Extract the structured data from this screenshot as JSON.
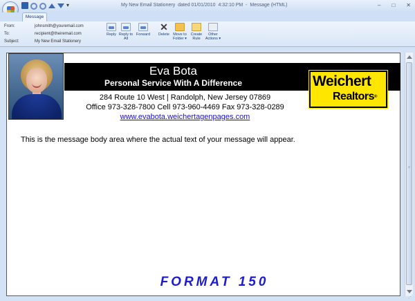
{
  "window": {
    "title": "My New Email Stationery  dated 01/01/2010  4:32:10 PM  -  Message (HTML)",
    "controls": [
      "–",
      "□",
      "✕"
    ]
  },
  "quick_access_icons": [
    "save-icon",
    "undo-icon",
    "redo-icon",
    "previous-item-icon",
    "next-item-icon",
    "customize-icon"
  ],
  "tabs": [
    {
      "label": "Message"
    }
  ],
  "header_fields": [
    {
      "label": "From:",
      "value": "johnsmith@youremail.com"
    },
    {
      "label": "To:",
      "value": "recipient@theiremail.com"
    },
    {
      "label": "Subject:",
      "value": "My New Email Stationery"
    }
  ],
  "ribbon": {
    "reply": "Reply",
    "reply_all": "Reply to All",
    "forward": "Forward",
    "delete": "Delete",
    "move_to_folder": "Move to Folder ▾",
    "create_rule": "Create Rule",
    "other_actions": "Other Actions ▾"
  },
  "signature": {
    "name": "Eva Bota",
    "tagline": "Personal Service With A Difference",
    "address": "284 Route 10 West | Randolph, New Jersey 07869",
    "phones": "Office 973-328-7800 Cell 973-960-4469 Fax 973-328-0289",
    "website": "www.evabota.weichertagenpages.com",
    "logo_line1": "Weichert",
    "logo_line2": "Realtors"
  },
  "body_text": "This is the message body area where the actual text of your message will appear.",
  "format_label": "FORMAT 150",
  "colors": {
    "banner": "#000000",
    "logo_yellow": "#ffe600",
    "link": "#1a10c8",
    "format_label": "#1d1ccd"
  }
}
